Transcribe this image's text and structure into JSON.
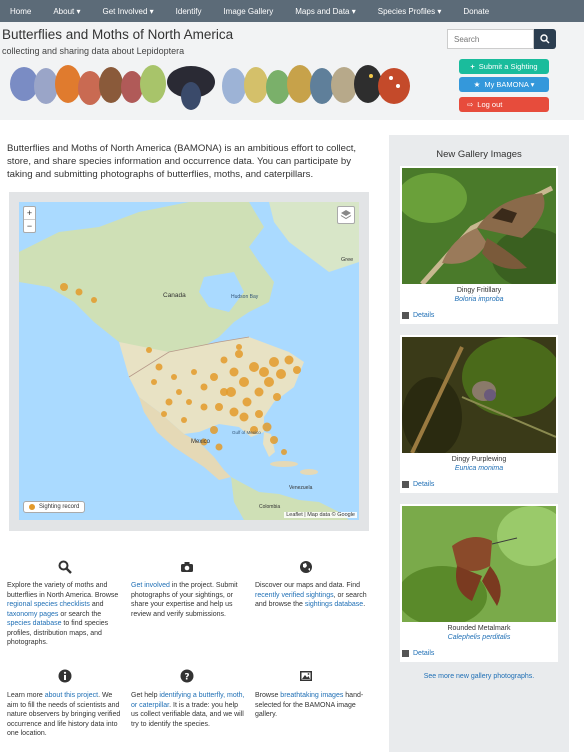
{
  "nav": {
    "items": [
      "Home",
      "About ▾",
      "Get Involved ▾",
      "Identify",
      "Image Gallery",
      "Maps and Data ▾",
      "Species Profiles ▾",
      "Donate"
    ]
  },
  "header": {
    "title": "Butterflies and Moths of North America",
    "subtitle": "collecting and sharing data about Lepidoptera",
    "search_placeholder": "Search",
    "submit_label": "Submit a Sighting",
    "mybamona_label": "My BAMONA ▾",
    "logout_label": "Log out",
    "colors": {
      "submit": "#1abc9c",
      "mybamona": "#3498db",
      "logout": "#e74c3c",
      "nav": "#5c6b78"
    }
  },
  "intro": "Butterflies and Moths of North America (BAMONA) is an ambitious effort to collect, store, and share species information and occurrence data. You can participate by taking and submitting photographs of butterflies, moths, and caterpillars.",
  "map": {
    "zoom_in": "+",
    "zoom_out": "−",
    "legend": "Sighting record",
    "attribution": "Leaflet | Map data © Google",
    "labels": {
      "canada": "Canada",
      "hudson": "Hudson Bay",
      "mexico": "Mexico",
      "greenland": "Gree",
      "gulf": "Gulf of Mexico",
      "venezuela": "Venezuela",
      "colombia": "Colombia"
    }
  },
  "features": [
    {
      "icon": "search-icon",
      "parts": [
        "Explore the variety of moths and butterflies in North America. Browse ",
        "regional species checklists",
        " and ",
        "taxonomy pages",
        " or search the ",
        "species database",
        " to find species profiles, distribution maps, and photographs."
      ]
    },
    {
      "icon": "camera-icon",
      "parts": [
        "",
        "Get involved",
        " in the project. Submit photographs of your sightings, or share your expertise and help us review and verify submissions."
      ]
    },
    {
      "icon": "globe-icon",
      "parts": [
        "Discover our maps and data. Find ",
        "recently verified sightings",
        ", or search and browse the ",
        "sightings database",
        "."
      ]
    },
    {
      "icon": "info-icon",
      "parts": [
        "Learn more ",
        "about this project",
        ". We aim to fill the needs of scientists and nature observers by bringing verified occurrence and life history data into one location."
      ]
    },
    {
      "icon": "question-icon",
      "parts": [
        "Get help ",
        "identifying a butterfly, moth, or caterpillar",
        ". It is a trade: you help us collect verifiable data, and we will try to identify the species."
      ]
    },
    {
      "icon": "image-icon",
      "parts": [
        "Browse ",
        "breathtaking images",
        " hand-selected for the BAMONA image gallery."
      ]
    }
  ],
  "sidebar": {
    "title": "New Gallery Images",
    "cards": [
      {
        "common": "Dingy Fritillary",
        "scientific": "Boloria improba",
        "details": "Details"
      },
      {
        "common": "Dingy Purplewing",
        "scientific": "Eunica monima",
        "details": "Details"
      },
      {
        "common": "Rounded Metalmark",
        "scientific": "Calephelis perditalis",
        "details": "Details"
      }
    ],
    "more": "See more new gallery photographs."
  }
}
